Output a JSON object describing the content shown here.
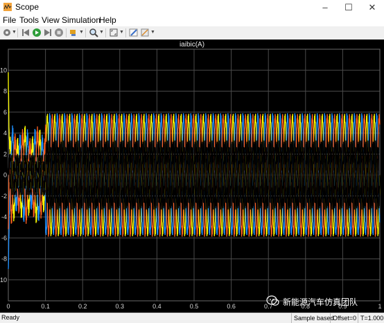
{
  "window": {
    "title": "Scope",
    "minimize": "–",
    "maximize": "☐",
    "close": "✕"
  },
  "menu": [
    {
      "label": "File",
      "key": "F"
    },
    {
      "label": "Tools",
      "key": "T"
    },
    {
      "label": "View",
      "key": "V"
    },
    {
      "label": "Simulation",
      "key": "S"
    },
    {
      "label": "Help",
      "key": "H"
    }
  ],
  "toolbar": {
    "icons": [
      "settings-icon",
      "step-back-icon",
      "run-icon",
      "step-forward-icon",
      "stop-icon",
      "highlight-icon",
      "zoom-icon",
      "fit-view-icon",
      "edit-style-icon"
    ]
  },
  "status": {
    "ready": "Ready",
    "sample_mode": "Sample based",
    "offset": "Offset=0",
    "time": "T=1.000"
  },
  "watermark": {
    "text": "新能源汽车仿真团队"
  },
  "colors": {
    "background": "#000000",
    "grid": "#4a4a4a",
    "axis_text": "#d8d8d8",
    "phase_a": "#ffff00",
    "phase_b": "#1e90ff",
    "phase_c": "#ff6020",
    "extra_trace": "#000000"
  },
  "chart_data": {
    "type": "line",
    "title": "iaibic(A)",
    "xlabel": "",
    "ylabel": "",
    "xlim": [
      0,
      1
    ],
    "ylim": [
      -12,
      12
    ],
    "x_ticks": [
      "0",
      "0.1",
      "0.2",
      "0.3",
      "0.4",
      "0.5",
      "0.6",
      "0.7",
      "0.8",
      "0.9",
      "1"
    ],
    "y_ticks": [
      "10",
      "8",
      "6",
      "4",
      "2",
      "0",
      "-2",
      "-4",
      "-6",
      "-8",
      "-10"
    ],
    "grid": true,
    "legend": "none",
    "series": [
      {
        "color": "#ffff00",
        "approx_amplitude": 5.5,
        "frequency_hz": 50,
        "phase_deg": 0
      },
      {
        "color": "#1e90ff",
        "approx_amplitude": 5.5,
        "frequency_hz": 50,
        "phase_deg": -120
      },
      {
        "color": "#ff6020",
        "approx_amplitude": 5.5,
        "frequency_hz": 50,
        "phase_deg": 120
      }
    ],
    "annotations": [
      "startup transient 0–0.1 s with peaks near 10 and -8",
      "steady state after 0.1 s"
    ]
  }
}
